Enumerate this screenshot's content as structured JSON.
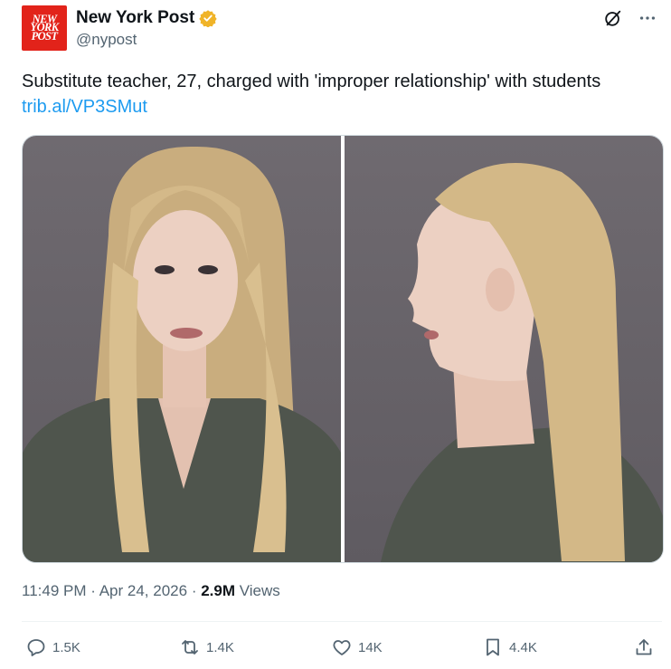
{
  "account": {
    "avatar_lines": [
      "NEW",
      "YORK",
      "POST"
    ],
    "display_name": "New York Post",
    "handle": "@nypost"
  },
  "tweet": {
    "text": "Substitute teacher, 27, charged with 'improper relationship' with students",
    "link": "trib.al/VP3SMut"
  },
  "meta": {
    "time": "11:49 PM",
    "separator": "·",
    "date": "Apr 24, 2026",
    "views_count": "2.9M",
    "views_label": "Views"
  },
  "actions": {
    "replies": "1.5K",
    "reposts": "1.4K",
    "likes": "14K",
    "bookmarks": "4.4K"
  },
  "icons": {
    "verified": "verified-badge-icon",
    "grok": "grok-icon",
    "more": "more-icon",
    "reply": "reply-icon",
    "repost": "repost-icon",
    "like": "like-icon",
    "bookmark": "bookmark-icon",
    "share": "share-icon"
  },
  "colors": {
    "brand_red": "#e2231a",
    "link_blue": "#1d9bf0",
    "secondary_text": "#536471",
    "badge_gold": "#f0b429"
  }
}
